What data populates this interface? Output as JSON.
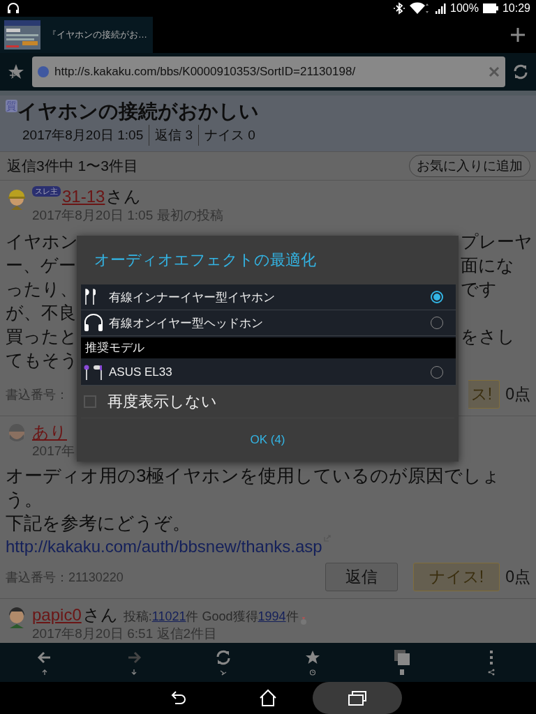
{
  "status_bar": {
    "battery": "100%",
    "time": "10:29"
  },
  "browser": {
    "tab": {
      "title": "『イヤホンの接続がお…",
      "selected": true
    },
    "url": "http://s.kakaku.com/bbs/K0000910353/SortID=21130198/"
  },
  "thread": {
    "badge": "質",
    "title": "イヤホンの接続がおかしい",
    "meta": [
      "2017年8月20日 1:05",
      "返信 3",
      "ナイス 0"
    ],
    "count": "返信3件中 1〜3件目",
    "favorite_button": "お気に入りに追加"
  },
  "posts": [
    {
      "badge": "スレ主",
      "user": "31-13",
      "suffix": "さん",
      "date": "2017年8月20日 1:05 最初の投稿",
      "body_lines": [
        {
          "left": "イヤホン",
          "right": "プレーヤ"
        },
        {
          "left": "ー、ゲー",
          "right": "面にな"
        },
        {
          "left": "ったり、",
          "right": "です"
        },
        {
          "left": "が、不良"
        },
        {
          "left": "買ったと",
          "right": "をさし"
        },
        {
          "left": "てもそう"
        }
      ],
      "post_number": "書込番号：",
      "nice_button": "ス!",
      "score": "0点"
    },
    {
      "user": "あり",
      "date": "2017年",
      "body": [
        "オーディオ用の3極イヤホンを使用しているのが原因でしょう。",
        "下記を参考にどうぞ。"
      ],
      "link": "http://kakaku.com/auth/bbsnew/thanks.asp",
      "post_number": "書込番号：21130220",
      "reply_button": "返信",
      "nice_button": "ナイス!",
      "score": "0点"
    },
    {
      "user": "papic0",
      "suffix": "さん",
      "stats": [
        {
          "kind": "text",
          "text": "投稿:"
        },
        {
          "kind": "link",
          "text": "11021"
        },
        {
          "kind": "text",
          "text": "件 Good獲得"
        },
        {
          "kind": "link",
          "text": "1994"
        },
        {
          "kind": "text",
          "text": "件"
        }
      ],
      "date": "2017年8月20日 6:51 返信2件目"
    }
  ],
  "dialog": {
    "title": "オーディオエフェクトの最適化",
    "items": [
      {
        "kind": "option",
        "label": "有線インナーイヤー型イヤホン",
        "selected": true
      },
      {
        "kind": "option",
        "label": "有線オンイヤー型ヘッドホン",
        "selected": false
      },
      {
        "kind": "header",
        "label": "推奨モデル"
      },
      {
        "kind": "option",
        "label": "ASUS EL33",
        "selected": false
      }
    ],
    "checkbox": {
      "label": "再度表示しない",
      "checked": false
    },
    "button": "OK (4)"
  }
}
